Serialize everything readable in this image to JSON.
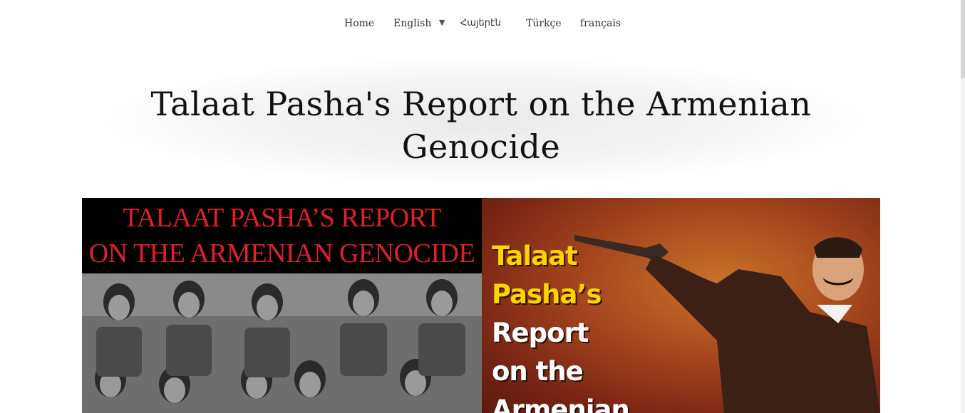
{
  "nav": {
    "items": [
      {
        "label": "Home"
      },
      {
        "label": "English"
      },
      {
        "label": "Հայերէն"
      },
      {
        "label": "Türkçe"
      },
      {
        "label": "français"
      }
    ],
    "dropdown_icon": "triangle-down-icon"
  },
  "page": {
    "title": "Talaat Pasha's Report on the Armenian Genocide"
  },
  "banner": {
    "left": {
      "line1": "TALAAT PASHA’S REPORT",
      "line2": "ON THE ARMENIAN GENOCIDE"
    },
    "right": {
      "lines": [
        "Talaat",
        "Pasha’s",
        "Report",
        "on the",
        "Armenian"
      ]
    },
    "colors": {
      "left_text": "#e0202a",
      "right_yellow": "#ffd400",
      "right_white": "#ffffff"
    }
  }
}
